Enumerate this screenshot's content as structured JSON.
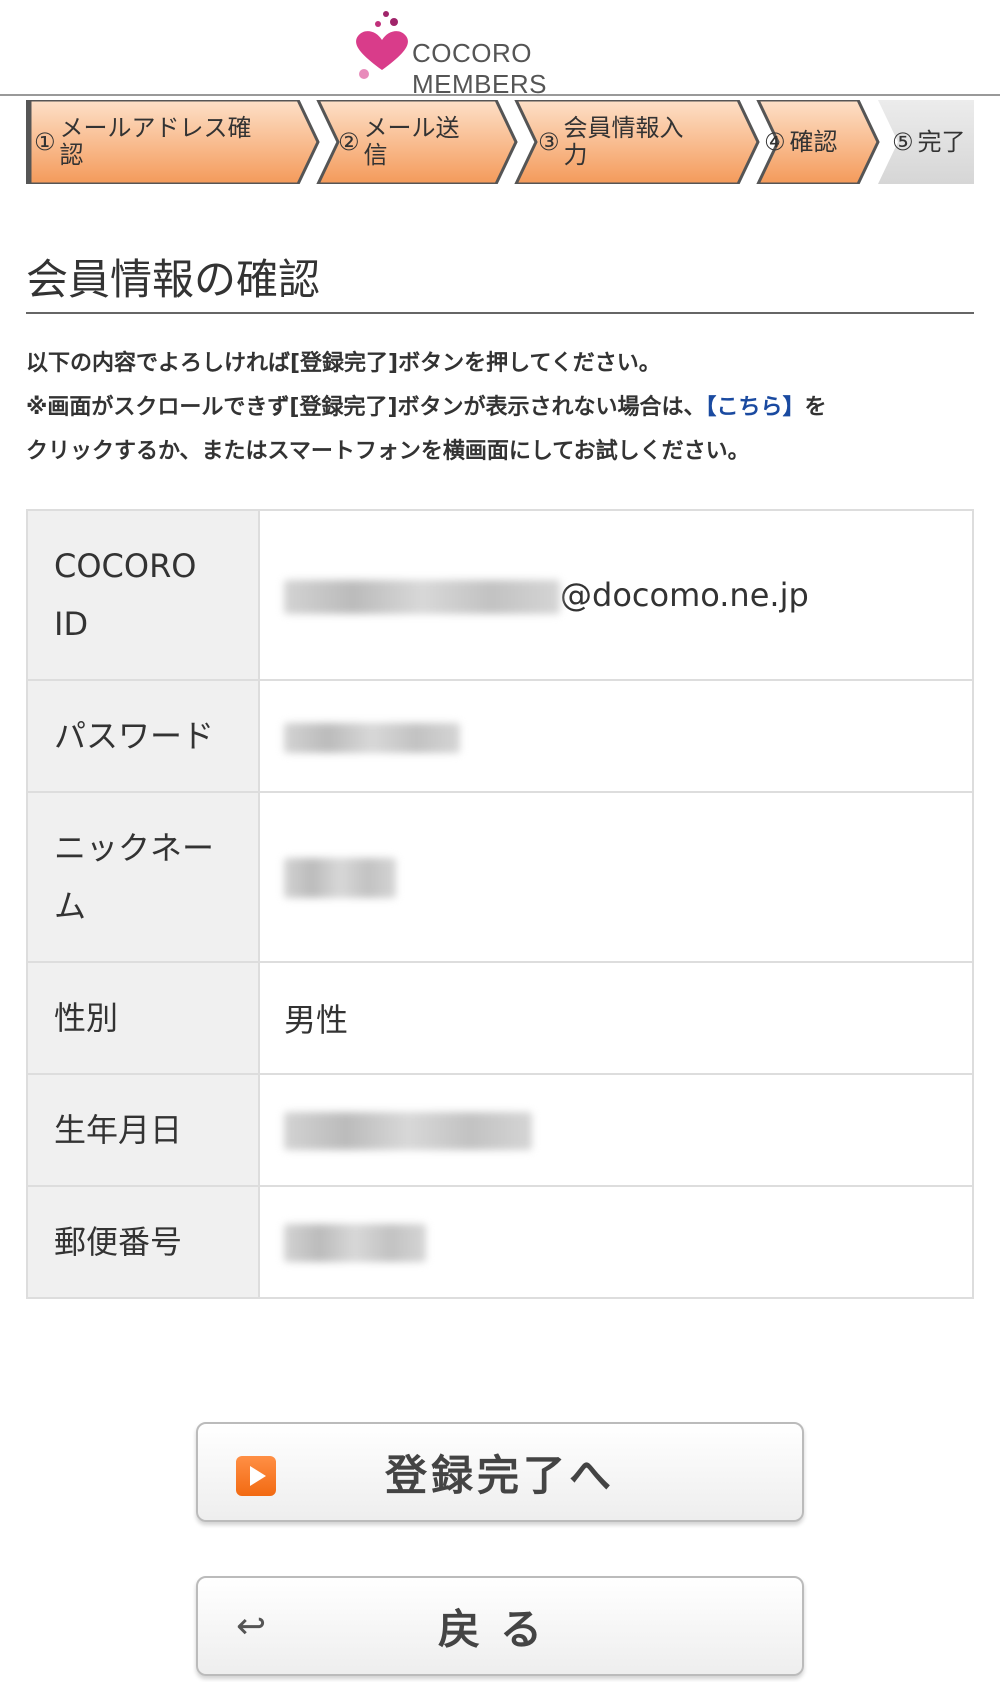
{
  "header": {
    "logo_text": "COCORO MEMBERS"
  },
  "steps": [
    {
      "num": "①",
      "label": "メールアドレス確認",
      "line1": "メールアドレス確",
      "line2": "認"
    },
    {
      "num": "②",
      "label": "メール送信",
      "line1": "メール送",
      "line2": "信"
    },
    {
      "num": "③",
      "label": "会員情報入力",
      "line1": "会員情報入",
      "line2": "力"
    },
    {
      "num": "④",
      "label": "確認"
    },
    {
      "num": "⑤",
      "label": "完了"
    }
  ],
  "page_title": "会員情報の確認",
  "instructions": {
    "line1": "以下の内容でよろしければ[登録完了]ボタンを押してください。",
    "line2_pre": "※画面がスクロールできず[登録完了]ボタンが表示されない場合は、",
    "link": "【こちら】",
    "line2_post": "を",
    "line3": "クリックするか、またはスマートフォンを横画面にしてお試しください。"
  },
  "table": {
    "rows": [
      {
        "label": "COCORO ID",
        "value_suffix": "@docomo.ne.jp"
      },
      {
        "label": "パスワード"
      },
      {
        "label": "ニックネーム"
      },
      {
        "label": "性別",
        "value": "男性"
      },
      {
        "label": "生年月日"
      },
      {
        "label": "郵便番号"
      }
    ]
  },
  "buttons": {
    "complete": "登録完了へ",
    "back": "戻る"
  },
  "colors": {
    "step_active": "#f7a468",
    "step_inactive": "#dcdcdc",
    "link": "#1a4aa0",
    "logo_pink": "#d93c8a"
  }
}
